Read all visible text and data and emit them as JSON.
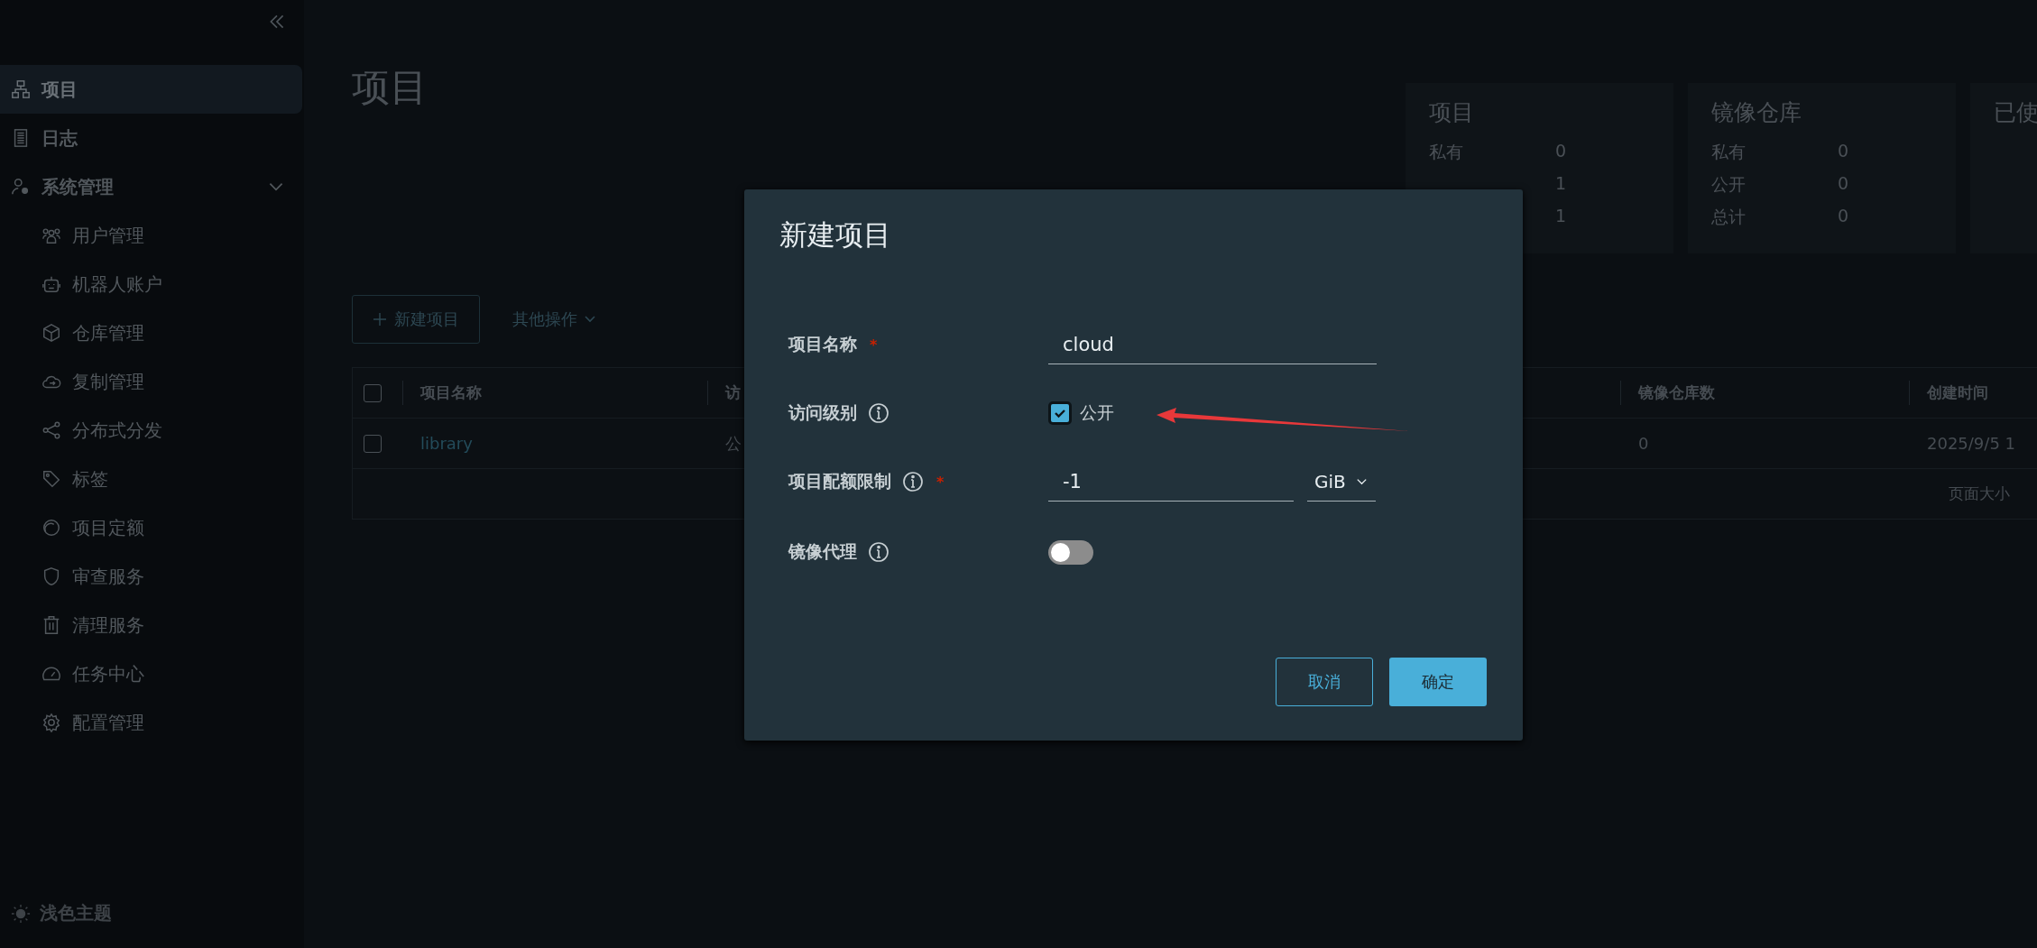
{
  "sidebar": {
    "items": [
      {
        "label": "项目",
        "selected": true
      },
      {
        "label": "日志",
        "selected": false
      },
      {
        "label": "系统管理",
        "selected": false,
        "expanded": true,
        "children": [
          {
            "label": "用户管理",
            "selected": false
          },
          {
            "label": "机器人账户",
            "selected": false
          },
          {
            "label": "仓库管理",
            "selected": false
          },
          {
            "label": "复制管理",
            "selected": false
          },
          {
            "label": "分布式分发",
            "selected": false
          },
          {
            "label": "标签",
            "selected": false
          },
          {
            "label": "项目定额",
            "selected": false
          },
          {
            "label": "审查服务",
            "selected": false
          },
          {
            "label": "清理服务",
            "selected": false
          },
          {
            "label": "任务中心",
            "selected": false
          },
          {
            "label": "配置管理",
            "selected": false
          }
        ]
      }
    ],
    "theme_toggle": "浅色主题"
  },
  "page": {
    "title": "项目",
    "stat_cards": [
      {
        "title": "项目",
        "rows": [
          {
            "label": "私有",
            "value": "0"
          },
          {
            "value": "1"
          },
          {
            "value": "1"
          }
        ]
      },
      {
        "title": "镜像仓库",
        "rows": [
          {
            "label": "私有",
            "value": "0"
          },
          {
            "label": "公开",
            "value": "0"
          },
          {
            "label": "总计",
            "value": "0"
          }
        ]
      },
      {
        "title": "已使"
      }
    ],
    "new_button": "新建项目",
    "more_actions": "其他操作",
    "table": {
      "header_checked": false,
      "columns": [
        "项目名称",
        "访",
        "镜像仓库数",
        "创建时间"
      ],
      "rows": [
        {
          "checked": false,
          "cells": [
            "library",
            "公",
            "0",
            "2025/9/5 1"
          ]
        }
      ],
      "footer": "页面大小"
    }
  },
  "dialog": {
    "title": "新建项目",
    "required_mark": "*",
    "fields": [
      {
        "kind": "text",
        "label": "项目名称",
        "info": false,
        "required": true,
        "value": "cloud"
      },
      {
        "kind": "checkbox",
        "label": "访问级别",
        "info": true,
        "required": false,
        "option": "公开",
        "checked": true
      },
      {
        "kind": "quota",
        "label": "项目配额限制",
        "info": true,
        "required": true,
        "value": "-1",
        "unit": "GiB"
      },
      {
        "kind": "toggle",
        "label": "镜像代理",
        "info": true,
        "required": false,
        "on": false
      }
    ],
    "buttons": [
      {
        "kind": "secondary",
        "label": "取消"
      },
      {
        "kind": "primary",
        "label": "确定"
      }
    ]
  }
}
